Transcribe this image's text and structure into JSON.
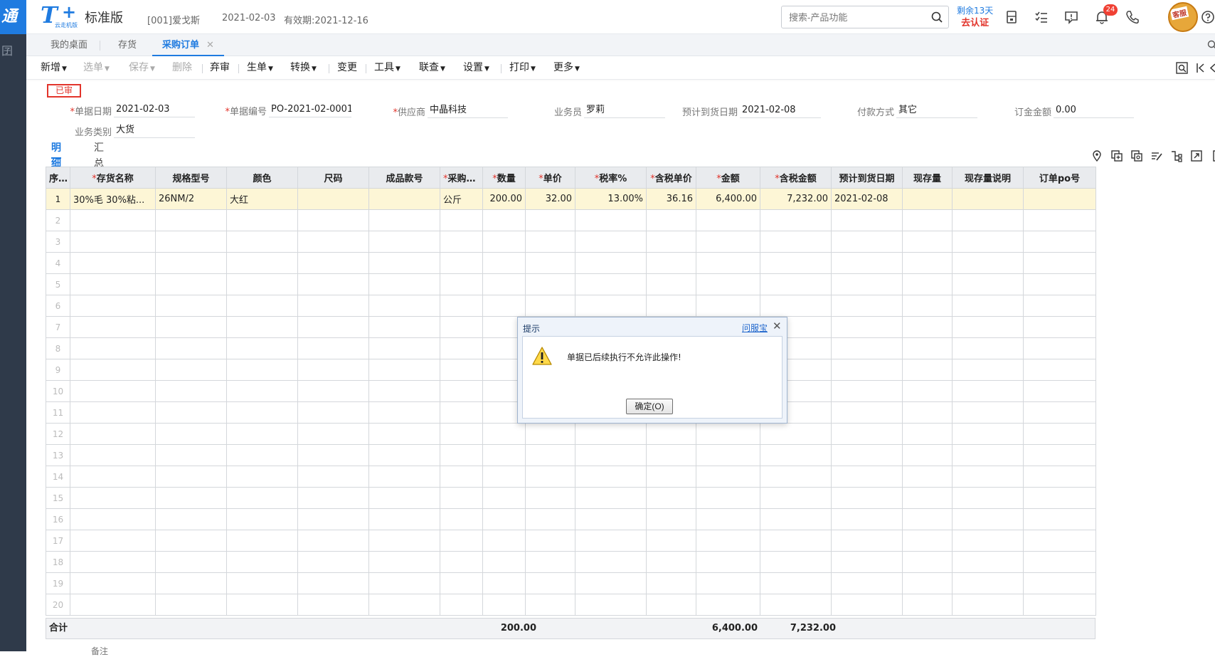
{
  "colors": {
    "accent": "#1f7be0",
    "danger": "#e2342b",
    "selected_row": "#fdf6d6"
  },
  "left_strip": {
    "glyph_top": "通",
    "glyph_2": "囝"
  },
  "brand": {
    "logo_text": "T",
    "logo_plus": "+",
    "logo_small": "云走机版",
    "edition": "标准版"
  },
  "header": {
    "account": "[001]爱戈斯",
    "date": "2021-02-03",
    "validity": "有效期:2021-12-16",
    "search_placeholder": "搜索-产品功能",
    "trial_days": "剩余13天",
    "trial_action": "去认证",
    "notification_count": "24",
    "avatar_label": "客服"
  },
  "tabs": [
    {
      "label": "我的桌面"
    },
    {
      "label": "存货"
    },
    {
      "label": "采购订单",
      "active": true
    }
  ],
  "toolbar": {
    "new": "新增",
    "select": "选单",
    "save": "保存",
    "delete": "删除",
    "abandon": "弃审",
    "generate": "生单",
    "convert": "转换",
    "change": "变更",
    "tools": "工具",
    "linked": "联查",
    "settings": "设置",
    "print": "打印",
    "more": "更多"
  },
  "status_stamp": "已审",
  "form": {
    "doc_date_label": "单据日期",
    "doc_date": "2021-02-03",
    "doc_no_label": "单据编号",
    "doc_no": "PO-2021-02-0001",
    "supplier_label": "供应商",
    "supplier": "中晶科技",
    "salesman_label": "业务员",
    "salesman": "罗莉",
    "arrival_label": "预计到货日期",
    "arrival": "2021-02-08",
    "payment_label": "付款方式",
    "payment": "其它",
    "deposit_label": "订金金额",
    "deposit": "0.00",
    "biz_type_label": "业务类别",
    "biz_type": "大货"
  },
  "subtabs": {
    "detail": "明细",
    "summary": "汇总"
  },
  "grid": {
    "headers": [
      "序号",
      "存货名称",
      "规格型号",
      "颜色",
      "尺码",
      "成品款号",
      "采购单位",
      "数量",
      "单价",
      "税率%",
      "含税单价",
      "金额",
      "含税金额",
      "预计到货日期",
      "现存量",
      "现存量说明",
      "订单po号"
    ],
    "required": [
      false,
      true,
      false,
      false,
      false,
      false,
      true,
      true,
      true,
      true,
      true,
      true,
      true,
      false,
      false,
      false,
      false
    ],
    "rows": [
      [
        "1",
        "30%毛 30%粘...",
        "26NM/2",
        "大红",
        "",
        "",
        "公斤",
        "200.00",
        "32.00",
        "13.00%",
        "36.16",
        "6,400.00",
        "7,232.00",
        "2021-02-08",
        "",
        "",
        ""
      ],
      [
        "2",
        "",
        "",
        "",
        "",
        "",
        "",
        "",
        "",
        "",
        "",
        "",
        "",
        "",
        "",
        "",
        ""
      ],
      [
        "3",
        "",
        "",
        "",
        "",
        "",
        "",
        "",
        "",
        "",
        "",
        "",
        "",
        "",
        "",
        "",
        ""
      ],
      [
        "4",
        "",
        "",
        "",
        "",
        "",
        "",
        "",
        "",
        "",
        "",
        "",
        "",
        "",
        "",
        "",
        ""
      ],
      [
        "5",
        "",
        "",
        "",
        "",
        "",
        "",
        "",
        "",
        "",
        "",
        "",
        "",
        "",
        "",
        "",
        ""
      ],
      [
        "6",
        "",
        "",
        "",
        "",
        "",
        "",
        "",
        "",
        "",
        "",
        "",
        "",
        "",
        "",
        "",
        ""
      ],
      [
        "7",
        "",
        "",
        "",
        "",
        "",
        "",
        "",
        "",
        "",
        "",
        "",
        "",
        "",
        "",
        "",
        ""
      ],
      [
        "8",
        "",
        "",
        "",
        "",
        "",
        "",
        "",
        "",
        "",
        "",
        "",
        "",
        "",
        "",
        "",
        ""
      ],
      [
        "9",
        "",
        "",
        "",
        "",
        "",
        "",
        "",
        "",
        "",
        "",
        "",
        "",
        "",
        "",
        "",
        ""
      ],
      [
        "10",
        "",
        "",
        "",
        "",
        "",
        "",
        "",
        "",
        "",
        "",
        "",
        "",
        "",
        "",
        "",
        ""
      ],
      [
        "11",
        "",
        "",
        "",
        "",
        "",
        "",
        "",
        "",
        "",
        "",
        "",
        "",
        "",
        "",
        "",
        ""
      ],
      [
        "12",
        "",
        "",
        "",
        "",
        "",
        "",
        "",
        "",
        "",
        "",
        "",
        "",
        "",
        "",
        "",
        ""
      ],
      [
        "13",
        "",
        "",
        "",
        "",
        "",
        "",
        "",
        "",
        "",
        "",
        "",
        "",
        "",
        "",
        "",
        ""
      ],
      [
        "14",
        "",
        "",
        "",
        "",
        "",
        "",
        "",
        "",
        "",
        "",
        "",
        "",
        "",
        "",
        "",
        ""
      ],
      [
        "15",
        "",
        "",
        "",
        "",
        "",
        "",
        "",
        "",
        "",
        "",
        "",
        "",
        "",
        "",
        "",
        ""
      ],
      [
        "16",
        "",
        "",
        "",
        "",
        "",
        "",
        "",
        "",
        "",
        "",
        "",
        "",
        "",
        "",
        "",
        ""
      ],
      [
        "17",
        "",
        "",
        "",
        "",
        "",
        "",
        "",
        "",
        "",
        "",
        "",
        "",
        "",
        "",
        "",
        ""
      ],
      [
        "18",
        "",
        "",
        "",
        "",
        "",
        "",
        "",
        "",
        "",
        "",
        "",
        "",
        "",
        "",
        "",
        ""
      ],
      [
        "19",
        "",
        "",
        "",
        "",
        "",
        "",
        "",
        "",
        "",
        "",
        "",
        "",
        "",
        "",
        "",
        ""
      ],
      [
        "20",
        "",
        "",
        "",
        "",
        "",
        "",
        "",
        "",
        "",
        "",
        "",
        "",
        "",
        "",
        "",
        ""
      ]
    ]
  },
  "totals": {
    "label": "合计",
    "qty": "200.00",
    "amount": "6,400.00",
    "tax_amount": "7,232.00"
  },
  "below_text": "备注",
  "dialog": {
    "title": "提示",
    "help": "问服宝",
    "close": "✕",
    "message": "单据已后续执行不允许此操作!",
    "ok": "确定(O)"
  }
}
